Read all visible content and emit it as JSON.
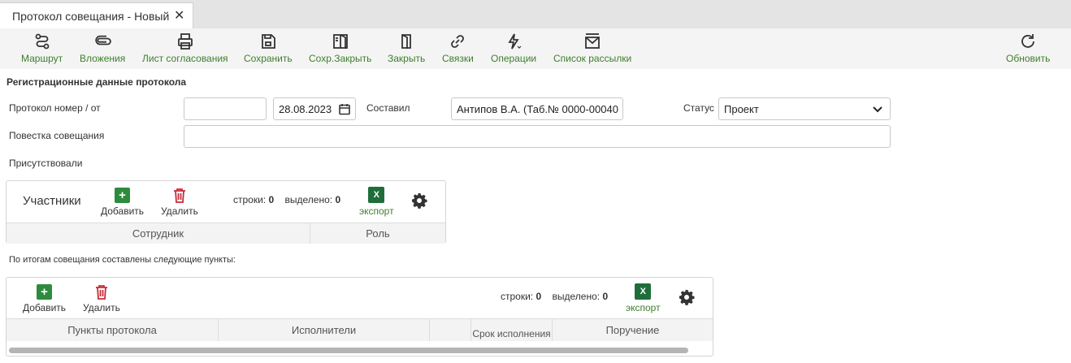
{
  "tab": {
    "title": "Протокол совещания - Новый"
  },
  "toolbar": {
    "route": "Маршрут",
    "attachments": "Вложения",
    "approval_sheet": "Лист согласования",
    "save": "Сохранить",
    "save_close": "Сохр.Закрыть",
    "close": "Закрыть",
    "links": "Связки",
    "operations": "Операции",
    "mailing_list": "Список рассылки",
    "refresh": "Обновить"
  },
  "form": {
    "section_title": "Регистрационные данные протокола",
    "number_label": "Протокол номер / от",
    "number_value": "",
    "date_value": "28.08.2023",
    "author_label": "Составил",
    "author_value": "Антипов В.А. (Таб.№ 0000-00040",
    "status_label": "Статус",
    "status_value": "Проект",
    "agenda_label": "Повестка совещания",
    "agenda_value": "",
    "present_label": "Присутствовали"
  },
  "participants": {
    "title": "Участники",
    "add": "Добавить",
    "delete": "Удалить",
    "rows_label": "строки:",
    "rows_value": "0",
    "selected_label": "выделено:",
    "selected_value": "0",
    "export_icon": "X",
    "export": "экспорт",
    "columns": [
      "Сотрудник",
      "Роль"
    ]
  },
  "results_label": "По итогам совещания составлены следующие пункты:",
  "items": {
    "add": "Добавить",
    "delete": "Удалить",
    "rows_label": "строки:",
    "rows_value": "0",
    "selected_label": "выделено:",
    "selected_value": "0",
    "export_icon": "X",
    "export": "экспорт",
    "columns": [
      "Пункты протокола",
      "Исполнители",
      "",
      "Срок исполнения",
      "Поручение"
    ]
  },
  "colors": {
    "accent_green": "#3e7f2c",
    "delete_red": "#c62d3a"
  }
}
